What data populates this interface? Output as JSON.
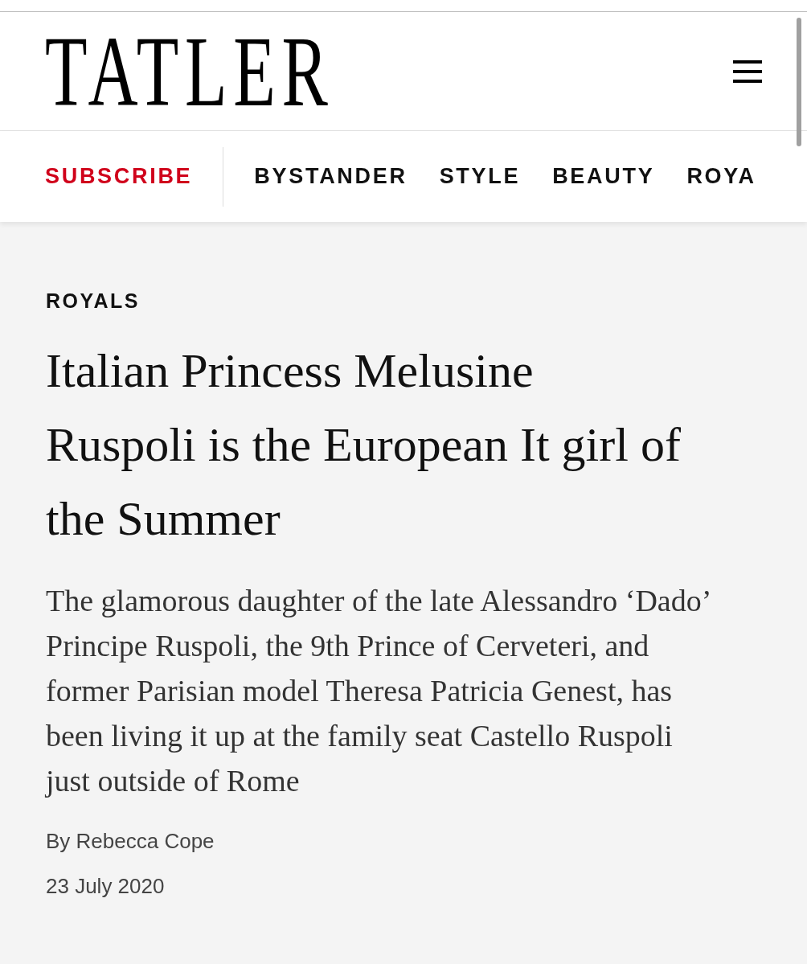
{
  "header": {
    "logo": "TATLER"
  },
  "nav": {
    "items": [
      {
        "label": "SUBSCRIBE",
        "kind": "subscribe"
      },
      {
        "label": "BYSTANDER",
        "kind": "link"
      },
      {
        "label": "STYLE",
        "kind": "link"
      },
      {
        "label": "BEAUTY",
        "kind": "link"
      },
      {
        "label": "ROYA",
        "kind": "link"
      }
    ]
  },
  "article": {
    "category": "ROYALS",
    "headline": "Italian Princess Melusine Ruspoli is the European It girl of the Summer",
    "standfirst": "The glamorous daughter of the late Alessandro ‘Dado’ Principe Ruspoli, the 9th Prince of Cerveteri, and former Parisian model Theresa Patricia Genest, has been living it up at the family seat Castello Ruspoli just outside of Rome",
    "byline": "By Rebecca Cope",
    "date": "23 July 2020"
  }
}
